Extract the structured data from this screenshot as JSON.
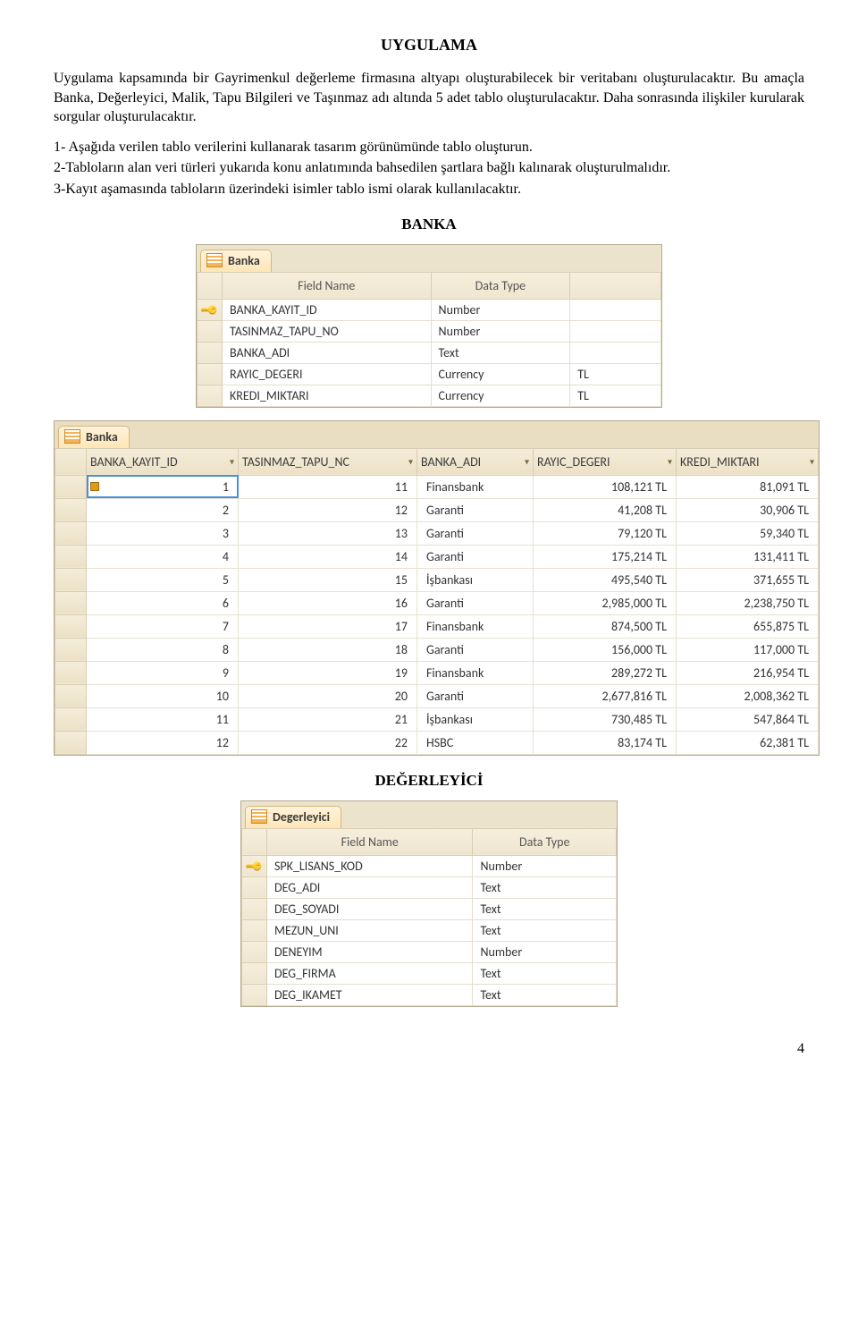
{
  "title": "UYGULAMA",
  "intro": "Uygulama kapsamında bir Gayrimenkul değerleme firmasına altyapı oluşturabilecek bir veritabanı oluşturulacaktır. Bu amaçla Banka, Değerleyici, Malik, Tapu Bilgileri ve Taşınmaz adı altında 5 adet tablo oluşturulacaktır. Daha sonrasında ilişkiler kurularak sorgular oluşturulacaktır.",
  "bullets": [
    "1- Aşağıda verilen tablo verilerini kullanarak tasarım görünümünde tablo oluşturun.",
    "2-Tabloların alan veri türleri yukarıda konu anlatımında bahsedilen şartlara bağlı kalınarak oluşturulmalıdır.",
    "3-Kayıt aşamasında tabloların üzerindeki isimler tablo ismi olarak kullanılacaktır."
  ],
  "section_banka": "BANKA",
  "section_degerleyici": "DEĞERLEYİCİ",
  "design_headers": {
    "field": "Field Name",
    "type": "Data Type",
    "extra": ""
  },
  "banka_design": {
    "tab": "Banka",
    "rows": [
      {
        "pk": true,
        "field": "BANKA_KAYIT_ID",
        "type": "Number",
        "extra": ""
      },
      {
        "pk": false,
        "field": "TASINMAZ_TAPU_NO",
        "type": "Number",
        "extra": ""
      },
      {
        "pk": false,
        "field": "BANKA_ADI",
        "type": "Text",
        "extra": ""
      },
      {
        "pk": false,
        "field": "RAYIC_DEGERI",
        "type": "Currency",
        "extra": "TL"
      },
      {
        "pk": false,
        "field": "KREDI_MIKTARI",
        "type": "Currency",
        "extra": "TL"
      }
    ]
  },
  "banka_data": {
    "tab": "Banka",
    "headers": [
      "BANKA_KAYIT_ID",
      "TASINMAZ_TAPU_NO",
      "BANKA_ADI",
      "RAYIC_DEGERI",
      "KREDI_MIKTARI"
    ],
    "header_display": [
      "BANKA_KAYIT_ID",
      "TASINMAZ_TAPU_NC",
      "BANKA_ADI",
      "RAYIC_DEGERI",
      "KREDI_MIKTARI"
    ],
    "rows": [
      {
        "id": "1",
        "tapu": "11",
        "banka": "Finansbank",
        "rayic": "108,121 TL",
        "kredi": "81,091 TL"
      },
      {
        "id": "2",
        "tapu": "12",
        "banka": "Garanti",
        "rayic": "41,208 TL",
        "kredi": "30,906 TL"
      },
      {
        "id": "3",
        "tapu": "13",
        "banka": "Garanti",
        "rayic": "79,120 TL",
        "kredi": "59,340 TL"
      },
      {
        "id": "4",
        "tapu": "14",
        "banka": "Garanti",
        "rayic": "175,214 TL",
        "kredi": "131,411 TL"
      },
      {
        "id": "5",
        "tapu": "15",
        "banka": "İşbankası",
        "rayic": "495,540 TL",
        "kredi": "371,655 TL"
      },
      {
        "id": "6",
        "tapu": "16",
        "banka": "Garanti",
        "rayic": "2,985,000 TL",
        "kredi": "2,238,750 TL"
      },
      {
        "id": "7",
        "tapu": "17",
        "banka": "Finansbank",
        "rayic": "874,500 TL",
        "kredi": "655,875 TL"
      },
      {
        "id": "8",
        "tapu": "18",
        "banka": "Garanti",
        "rayic": "156,000 TL",
        "kredi": "117,000 TL"
      },
      {
        "id": "9",
        "tapu": "19",
        "banka": "Finansbank",
        "rayic": "289,272 TL",
        "kredi": "216,954 TL"
      },
      {
        "id": "10",
        "tapu": "20",
        "banka": "Garanti",
        "rayic": "2,677,816 TL",
        "kredi": "2,008,362 TL"
      },
      {
        "id": "11",
        "tapu": "21",
        "banka": "İşbankası",
        "rayic": "730,485 TL",
        "kredi": "547,864 TL"
      },
      {
        "id": "12",
        "tapu": "22",
        "banka": "HSBC",
        "rayic": "83,174 TL",
        "kredi": "62,381 TL"
      }
    ]
  },
  "degerleyici_design": {
    "tab": "Degerleyici",
    "rows": [
      {
        "pk": true,
        "field": "SPK_LISANS_KOD",
        "type": "Number"
      },
      {
        "pk": false,
        "field": "DEG_ADI",
        "type": "Text"
      },
      {
        "pk": false,
        "field": "DEG_SOYADI",
        "type": "Text"
      },
      {
        "pk": false,
        "field": "MEZUN_UNI",
        "type": "Text"
      },
      {
        "pk": false,
        "field": "DENEYIM",
        "type": "Number"
      },
      {
        "pk": false,
        "field": "DEG_FIRMA",
        "type": "Text"
      },
      {
        "pk": false,
        "field": "DEG_IKAMET",
        "type": "Text"
      }
    ]
  },
  "page_number": "4"
}
